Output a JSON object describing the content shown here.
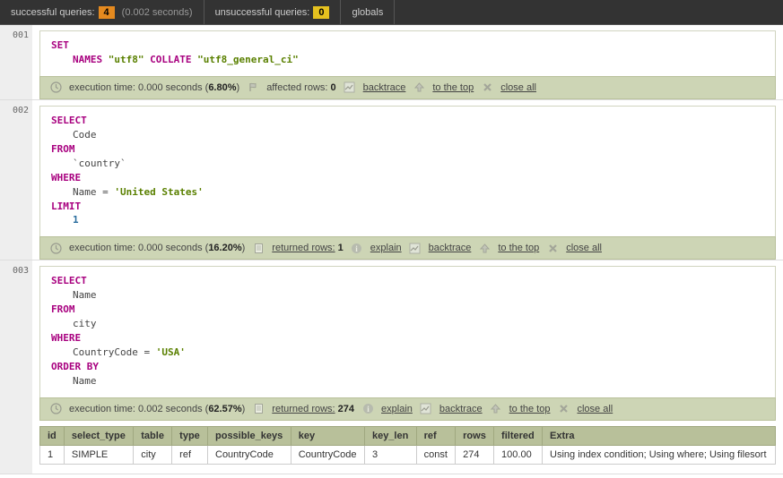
{
  "header": {
    "successful_label": "successful queries:",
    "successful_count": "4",
    "successful_time": "(0.002 seconds)",
    "unsuccessful_label": "unsuccessful queries:",
    "unsuccessful_count": "0",
    "globals_label": "globals"
  },
  "queries": [
    {
      "num": "001",
      "parts": [
        {
          "t": "kw",
          "v": "SET"
        },
        {
          "t": "br"
        },
        {
          "t": "ind"
        },
        {
          "t": "kw",
          "v": "NAMES"
        },
        {
          "t": "sp"
        },
        {
          "t": "str",
          "v": "\"utf8\""
        },
        {
          "t": "sp"
        },
        {
          "t": "kw",
          "v": "COLLATE"
        },
        {
          "t": "sp"
        },
        {
          "t": "str",
          "v": "\"utf8_general_ci\""
        }
      ],
      "stat": {
        "exec_label": "execution time:",
        "exec": "0.000 seconds",
        "pct": "6.80%",
        "affected_label": "affected rows:",
        "affected": "0",
        "backtrace": "backtrace",
        "totop": "to the top",
        "closeall": "close all"
      }
    },
    {
      "num": "002",
      "parts": [
        {
          "t": "kw",
          "v": "SELECT"
        },
        {
          "t": "br"
        },
        {
          "t": "ind"
        },
        {
          "t": "col",
          "v": "Code"
        },
        {
          "t": "br"
        },
        {
          "t": "kw",
          "v": "FROM"
        },
        {
          "t": "br"
        },
        {
          "t": "ind"
        },
        {
          "t": "col",
          "v": "`country`"
        },
        {
          "t": "br"
        },
        {
          "t": "kw",
          "v": "WHERE"
        },
        {
          "t": "br"
        },
        {
          "t": "ind"
        },
        {
          "t": "col",
          "v": "Name = "
        },
        {
          "t": "str",
          "v": "'United States'"
        },
        {
          "t": "br"
        },
        {
          "t": "kw",
          "v": "LIMIT"
        },
        {
          "t": "br"
        },
        {
          "t": "ind"
        },
        {
          "t": "num",
          "v": "1"
        }
      ],
      "stat": {
        "exec_label": "execution time:",
        "exec": "0.000 seconds",
        "pct": "16.20%",
        "returned_label": "returned rows:",
        "returned": "1",
        "explain": "explain",
        "backtrace": "backtrace",
        "totop": "to the top",
        "closeall": "close all"
      }
    },
    {
      "num": "003",
      "parts": [
        {
          "t": "kw",
          "v": "SELECT"
        },
        {
          "t": "br"
        },
        {
          "t": "ind"
        },
        {
          "t": "col",
          "v": "Name"
        },
        {
          "t": "br"
        },
        {
          "t": "kw",
          "v": "FROM"
        },
        {
          "t": "br"
        },
        {
          "t": "ind"
        },
        {
          "t": "col",
          "v": "city"
        },
        {
          "t": "br"
        },
        {
          "t": "kw",
          "v": "WHERE"
        },
        {
          "t": "br"
        },
        {
          "t": "ind"
        },
        {
          "t": "col",
          "v": "CountryCode = "
        },
        {
          "t": "str",
          "v": "'USA'"
        },
        {
          "t": "br"
        },
        {
          "t": "kw",
          "v": "ORDER BY"
        },
        {
          "t": "br"
        },
        {
          "t": "ind"
        },
        {
          "t": "col",
          "v": "Name"
        }
      ],
      "stat": {
        "exec_label": "execution time:",
        "exec": "0.002 seconds",
        "pct": "62.57%",
        "returned_label": "returned rows:",
        "returned": "274",
        "explain": "explain",
        "backtrace": "backtrace",
        "totop": "to the top",
        "closeall": "close all"
      },
      "explain_table": {
        "headers": [
          "id",
          "select_type",
          "table",
          "type",
          "possible_keys",
          "key",
          "key_len",
          "ref",
          "rows",
          "filtered",
          "Extra"
        ],
        "row": [
          "1",
          "SIMPLE",
          "city",
          "ref",
          "CountryCode",
          "CountryCode",
          "3",
          "const",
          "274",
          "100.00",
          "Using index condition; Using where; Using filesort"
        ]
      }
    }
  ]
}
